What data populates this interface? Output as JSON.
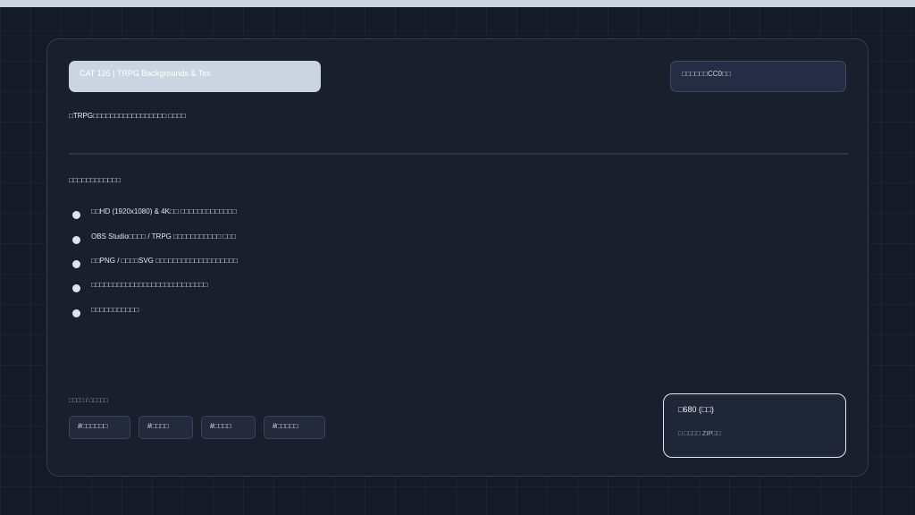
{
  "product": {
    "title": "CAT 126 | TRPG Backgrounds & Tex",
    "license": "□□□□□□CC0□□",
    "description": "□TRPG□□□□□□□□□□□□□□□□□ □□□□"
  },
  "features": {
    "heading": "□□□□□□□□□□□□",
    "items": [
      "□□HD (1920x1080) & 4K□□ □□□□□□□□□□□□□",
      "OBS Studio□□□□ / TRPG □□□□□□□□□□□ □□□",
      "□□PNG / □□□□SVG □□□□□□□□□□□□□□□□□□□",
      "□□□□□□□□□□□□□□□□□□□□□□□□□□□",
      "□□□□□□□□□□□"
    ]
  },
  "tags": {
    "label": "□□□□ / □□□□□",
    "items": [
      "#□□□□□□",
      "#□□□□",
      "#□□□□",
      "#□□□□□"
    ]
  },
  "pricing": {
    "price": "□680 (□□)",
    "note": "□ □□□□ ZIP□□"
  },
  "colors": {
    "background": "#141a27",
    "card": "#1a1f2e",
    "title_pill": "#cbd5e1",
    "accent_border": "#e2e8f0"
  }
}
